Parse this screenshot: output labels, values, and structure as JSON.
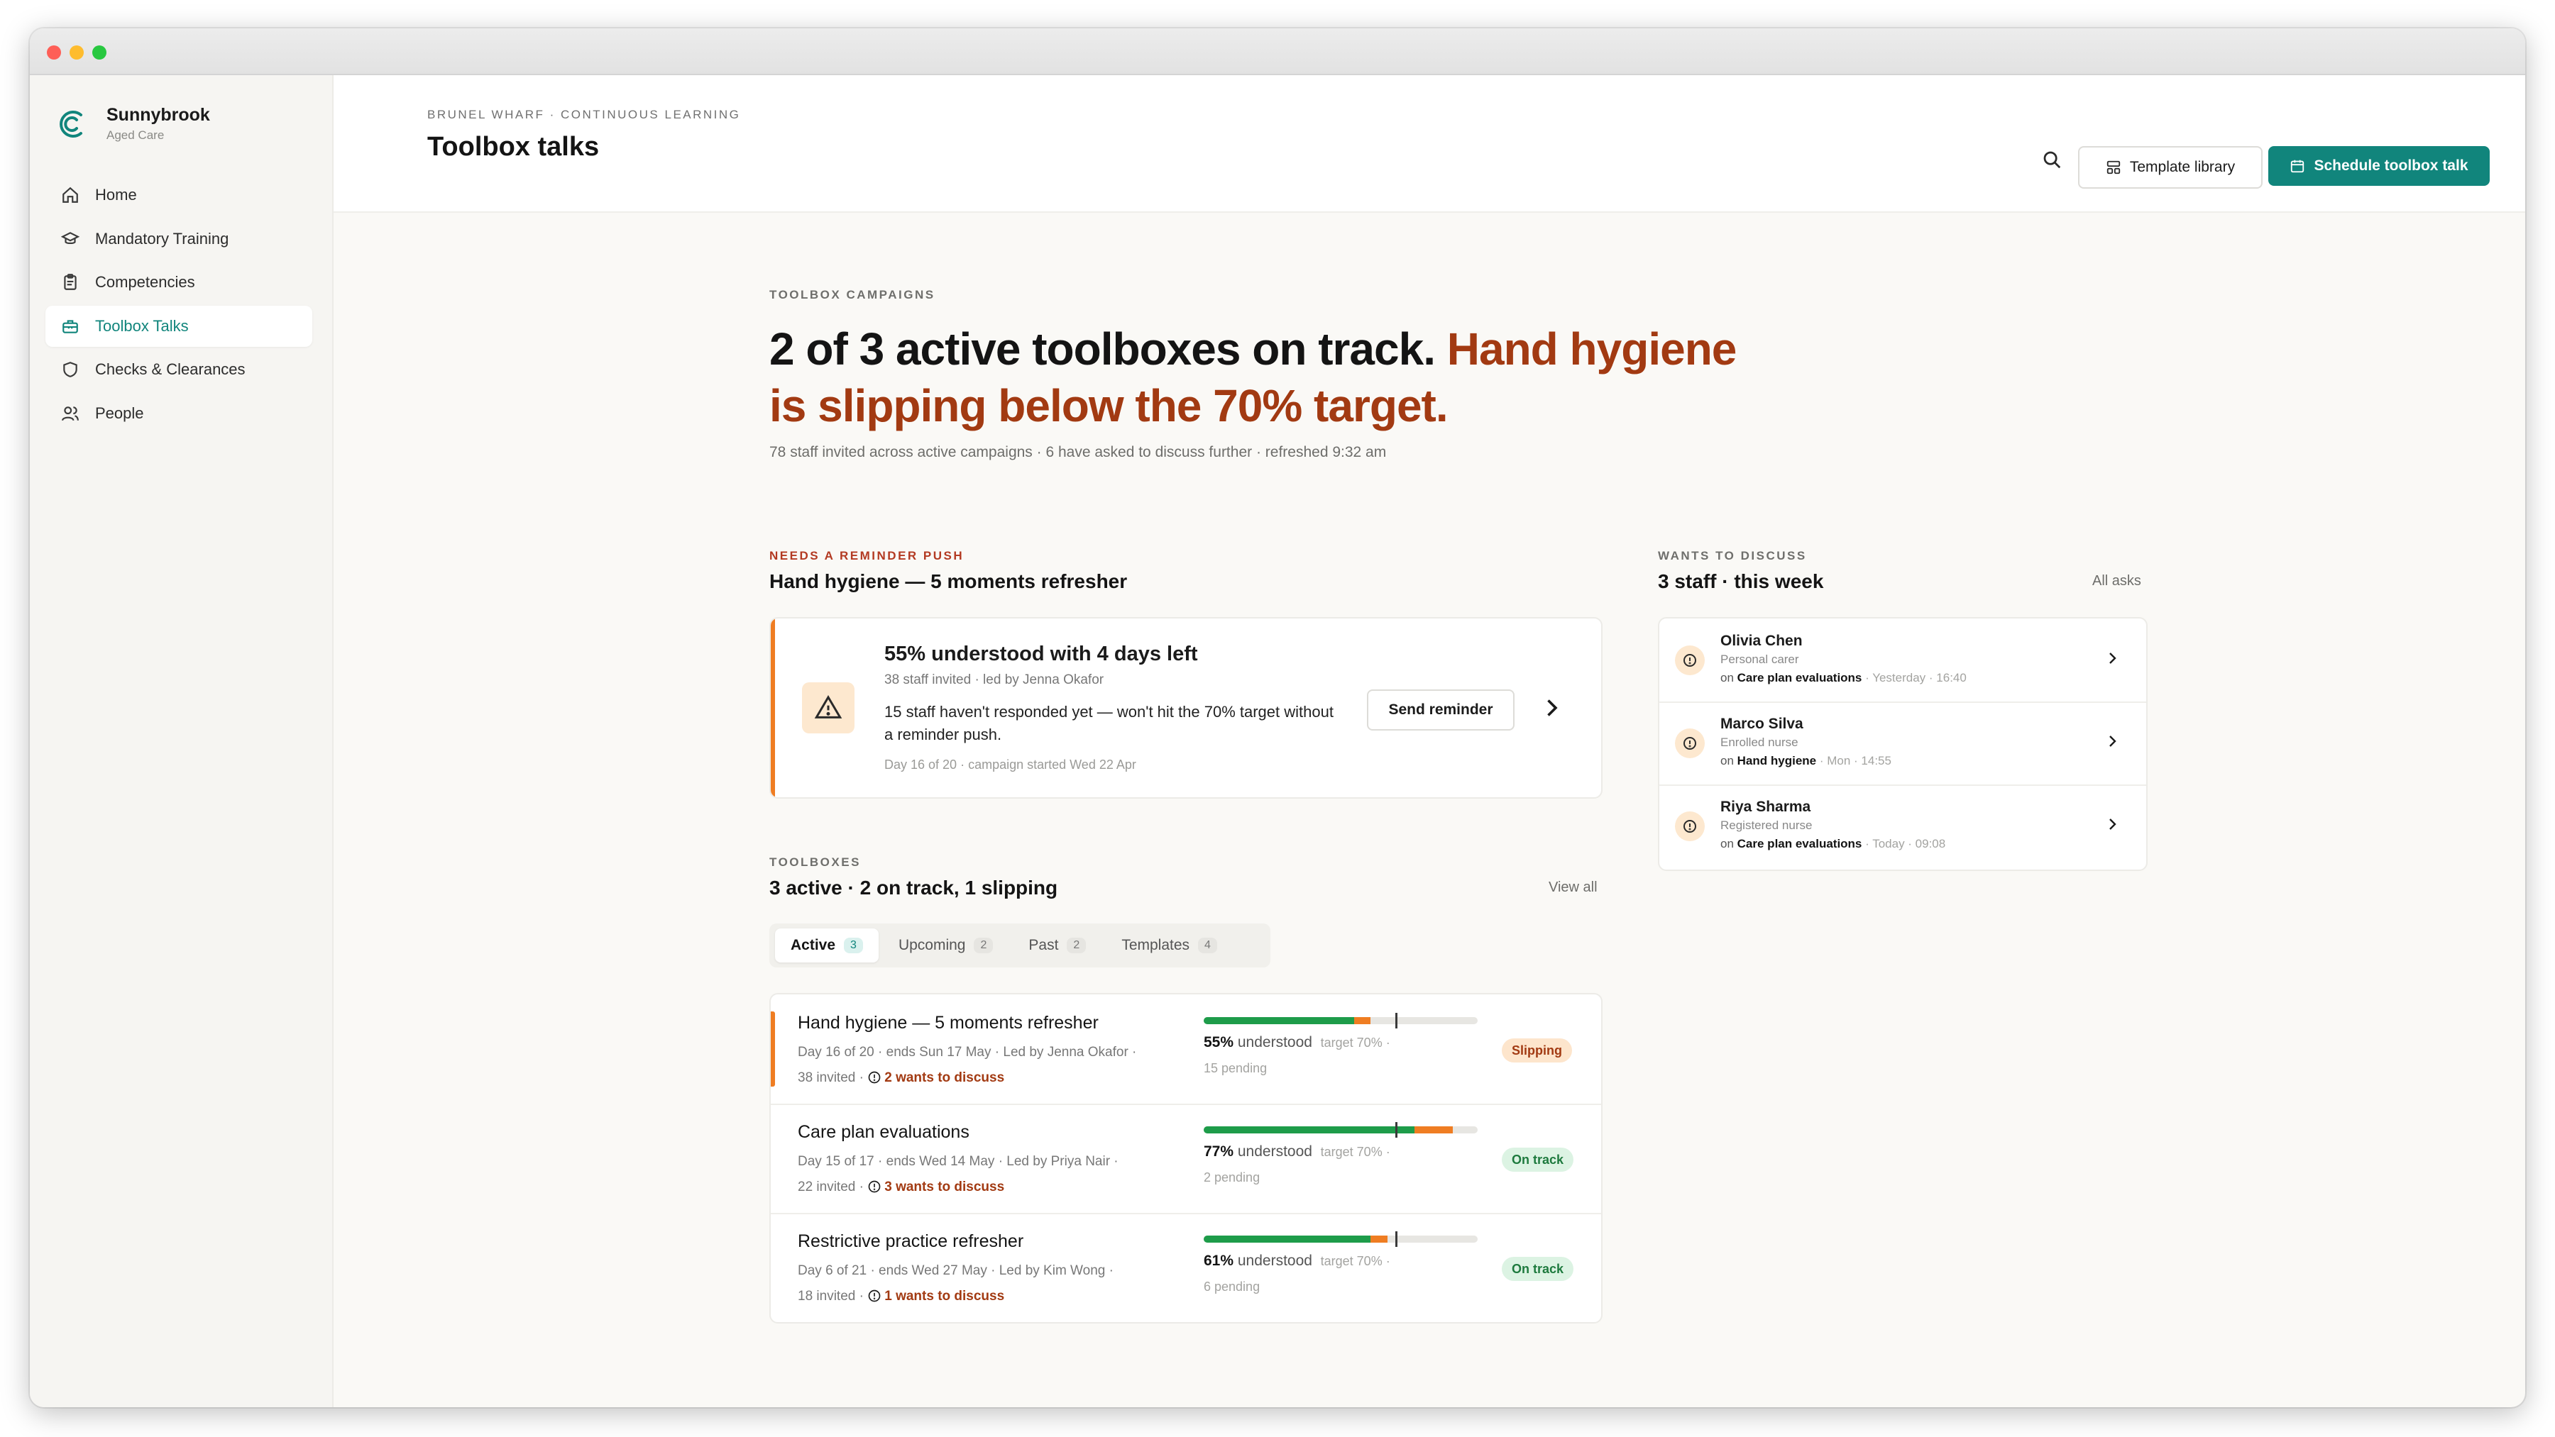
{
  "sidebar": {
    "brand_name": "Sunnybrook",
    "brand_sub": "Aged Care",
    "items": [
      {
        "label": "Home",
        "icon": "home-icon"
      },
      {
        "label": "Mandatory Training",
        "icon": "graduation-cap-icon"
      },
      {
        "label": "Competencies",
        "icon": "clipboard-icon"
      },
      {
        "label": "Toolbox Talks",
        "icon": "toolbox-icon",
        "active": true
      },
      {
        "label": "Checks & Clearances",
        "icon": "shield-icon"
      },
      {
        "label": "People",
        "icon": "people-icon"
      }
    ]
  },
  "header": {
    "breadcrumb": "BRUNEL WHARF · CONTINUOUS LEARNING",
    "title": "Toolbox talks",
    "template_library_label": "Template library",
    "schedule_label": "Schedule toolbox talk"
  },
  "hero": {
    "eyebrow": "TOOLBOX CAMPAIGNS",
    "headline_a": "2 of 3 active toolboxes on track. ",
    "headline_b": "Hand hygiene is slipping below the 70% target.",
    "subline": "78 staff invited across active campaigns · 6 have asked to discuss further · refreshed 9:32 am"
  },
  "reminder": {
    "eyebrow": "NEEDS A REMINDER PUSH",
    "section_title": "Hand hygiene — 5 moments refresher",
    "card_title": "55% understood with 4 days left",
    "card_meta": "38 staff invited · led by Jenna Okafor",
    "card_body": "15 staff haven't responded yet — won't hit the 70% target without a reminder push.",
    "card_foot": "Day 16 of 20 · campaign started Wed 22 Apr",
    "button_label": "Send reminder"
  },
  "toolboxes": {
    "eyebrow": "TOOLBOXES",
    "section_title": "3 active · 2 on track, 1 slipping",
    "view_all": "View all",
    "tabs": [
      {
        "label": "Active",
        "count": "3",
        "active": true
      },
      {
        "label": "Upcoming",
        "count": "2"
      },
      {
        "label": "Past",
        "count": "2"
      },
      {
        "label": "Templates",
        "count": "4"
      }
    ],
    "rows": [
      {
        "title": "Hand hygiene — 5 moments refresher",
        "meta": "Day 16 of 20 · ends Sun 17 May · Led by Jenna Okafor ·",
        "invited": "38 invited",
        "discuss": "2 wants to discuss",
        "pct_text": "55%",
        "understood": "understood",
        "target": "target 70% ·",
        "pending": "15 pending",
        "understood_frac": 0.55,
        "pending_frac": 0.06,
        "target_frac": 0.7,
        "status": "Slipping",
        "status_color": "#a23a12"
      },
      {
        "title": "Care plan evaluations",
        "meta": "Day 15 of 17 · ends Wed 14 May · Led by Priya Nair ·",
        "invited": "22 invited",
        "discuss": "3 wants to discuss",
        "pct_text": "77%",
        "understood": "understood",
        "target": "target 70% ·",
        "pending": "2 pending",
        "understood_frac": 0.77,
        "pending_frac": 0.14,
        "target_frac": 0.7,
        "status": "On track",
        "status_color": "#1e7a3e"
      },
      {
        "title": "Restrictive practice refresher",
        "meta": "Day 6 of 21 · ends Wed 27 May · Led by Kim Wong ·",
        "invited": "18 invited",
        "discuss": "1 wants to discuss",
        "pct_text": "61%",
        "understood": "understood",
        "target": "target 70% ·",
        "pending": "6 pending",
        "understood_frac": 0.61,
        "pending_frac": 0.06,
        "target_frac": 0.7,
        "status": "On track",
        "status_color": "#1e7a3e"
      }
    ]
  },
  "discuss": {
    "eyebrow": "WANTS TO DISCUSS",
    "section_title": "3 staff · this week",
    "all_asks": "All asks",
    "items": [
      {
        "name": "Olivia Chen",
        "role": "Personal carer",
        "on": "on",
        "topic": "Care plan evaluations",
        "time": "· Yesterday · 16:40"
      },
      {
        "name": "Marco Silva",
        "role": "Enrolled nurse",
        "on": "on",
        "topic": "Hand hygiene",
        "time": "· Mon · 14:55"
      },
      {
        "name": "Riya Sharma",
        "role": "Registered nurse",
        "on": "on",
        "topic": "Care plan evaluations",
        "time": "· Today · 09:08"
      }
    ]
  },
  "colors": {
    "accent": "#11857c",
    "warning": "#ef7d22",
    "slip_text": "#a23a12",
    "ok_green": "#1e9c4a"
  }
}
